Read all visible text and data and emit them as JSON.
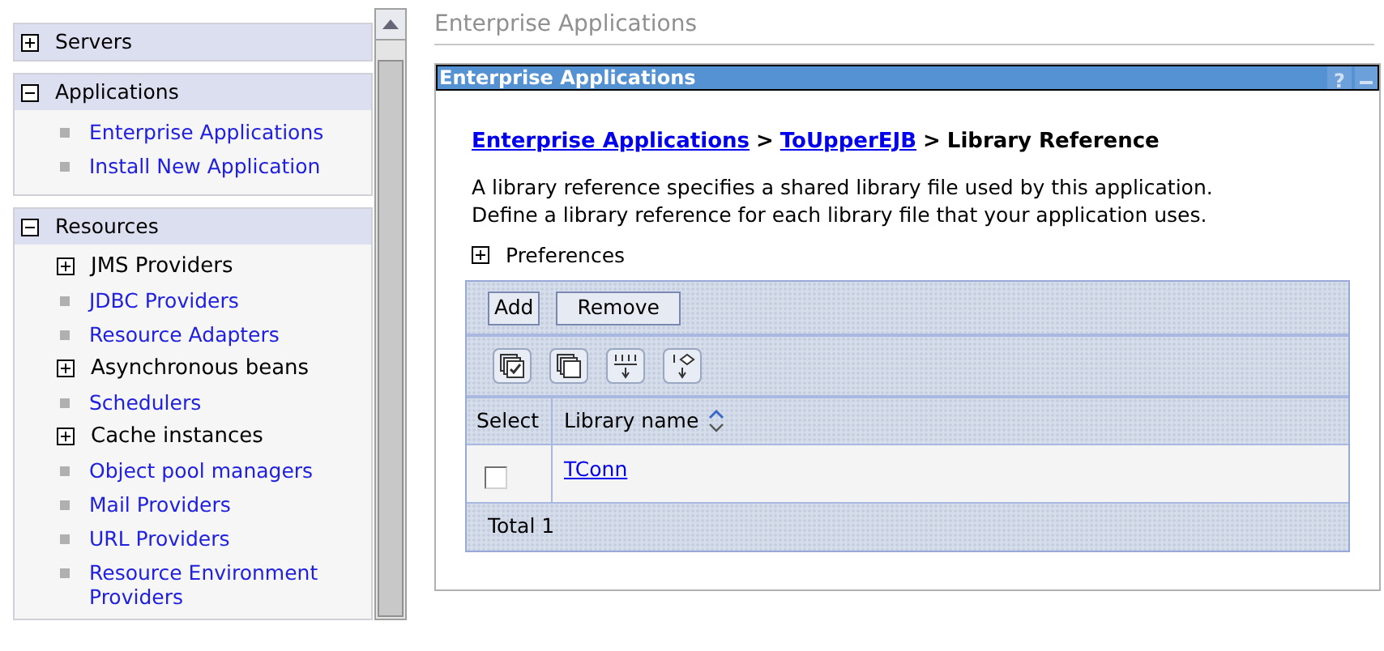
{
  "sidebar": {
    "sections": [
      {
        "title": "Servers",
        "expanded": false
      },
      {
        "title": "Applications",
        "expanded": true,
        "items": [
          {
            "kind": "link",
            "label": "Enterprise Applications"
          },
          {
            "kind": "link",
            "label": "Install New Application"
          }
        ]
      },
      {
        "title": "Resources",
        "expanded": true,
        "items": [
          {
            "kind": "folder",
            "label": "JMS Providers",
            "expanded": false
          },
          {
            "kind": "link",
            "label": "JDBC Providers"
          },
          {
            "kind": "link",
            "label": "Resource Adapters"
          },
          {
            "kind": "folder",
            "label": "Asynchronous beans",
            "expanded": false
          },
          {
            "kind": "link",
            "label": "Schedulers"
          },
          {
            "kind": "folder",
            "label": "Cache instances",
            "expanded": false
          },
          {
            "kind": "link",
            "label": "Object pool managers"
          },
          {
            "kind": "link",
            "label": "Mail Providers"
          },
          {
            "kind": "link",
            "label": "URL Providers"
          },
          {
            "kind": "link",
            "label": "Resource Environment Providers"
          }
        ]
      }
    ]
  },
  "page_title": "Enterprise Applications",
  "panel": {
    "title": "Enterprise Applications",
    "help": "?",
    "breadcrumb": [
      {
        "label": "Enterprise Applications",
        "link": true
      },
      {
        "label": ">",
        "link": false
      },
      {
        "label": "ToUpperEJB",
        "link": true
      },
      {
        "label": ">",
        "link": false
      },
      {
        "label": "Library Reference",
        "link": false
      }
    ],
    "description": [
      "A library reference specifies a shared library file used by this application.",
      "Define a library reference for each library file that your application uses."
    ],
    "preferences": {
      "label": "Preferences",
      "expanded": false
    },
    "buttons": [
      "Add",
      "Remove"
    ],
    "table": {
      "columns": [
        "Select",
        "Library name"
      ],
      "rows": [
        {
          "checked": false,
          "name": "TConn"
        }
      ],
      "total": "Total 1"
    }
  }
}
